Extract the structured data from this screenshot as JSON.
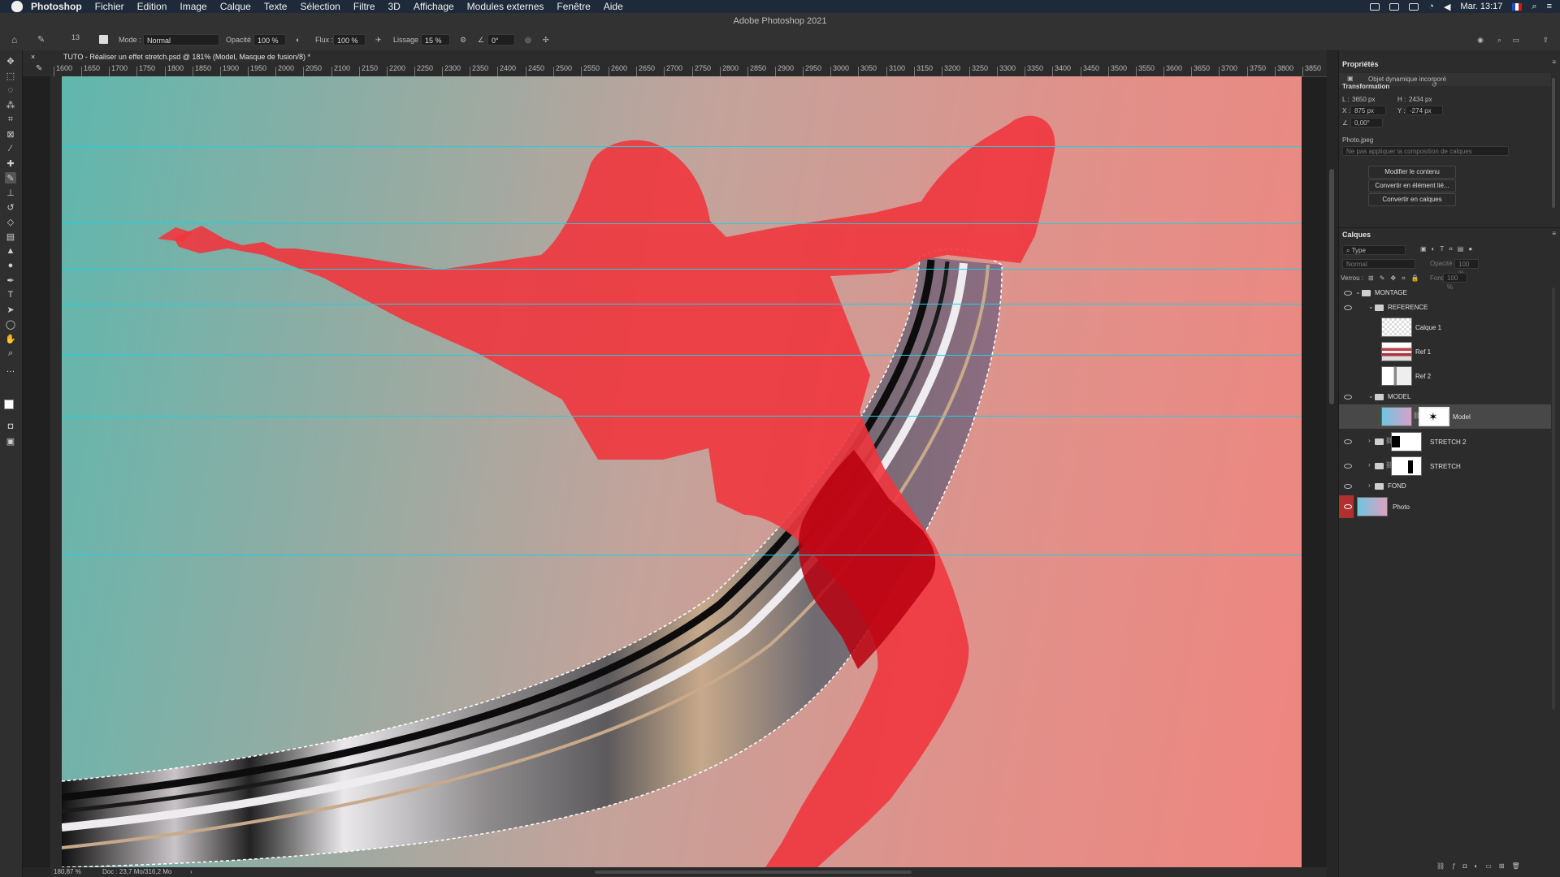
{
  "menubar": {
    "app": "Photoshop",
    "items": [
      "Fichier",
      "Edition",
      "Image",
      "Calque",
      "Texte",
      "Sélection",
      "Filtre",
      "3D",
      "Affichage",
      "Modules externes",
      "Fenêtre",
      "Aide"
    ],
    "clock": "Mar. 13:17"
  },
  "window": {
    "title": "Adobe Photoshop 2021"
  },
  "options": {
    "brush_size": "13",
    "mode_label": "Mode :",
    "mode_value": "Normal",
    "opacity_label": "Opacité :",
    "opacity_value": "100 %",
    "flow_label": "Flux :",
    "flow_value": "100 %",
    "smoothing_label": "Lissage :",
    "smoothing_value": "15 %",
    "angle_value": "0°"
  },
  "document": {
    "tab_title": "TUTO - Réaliser un effet stretch.psd @ 181% (Model, Masque de fusion/8) *",
    "ruler_ticks": [
      "1600",
      "1650",
      "1700",
      "1750",
      "1800",
      "1850",
      "1900",
      "1950",
      "2000",
      "2050",
      "2100",
      "2150",
      "2200",
      "2250",
      "2300",
      "2350",
      "2400",
      "2450",
      "2500",
      "2550",
      "2600",
      "2650",
      "2700",
      "2750",
      "2800",
      "2850",
      "2900",
      "2950",
      "3000",
      "3050",
      "3100",
      "3150",
      "3200",
      "3250",
      "3300",
      "3350",
      "3400",
      "3450",
      "3500",
      "3550",
      "3600",
      "3650",
      "3700",
      "3750",
      "3800",
      "3850"
    ],
    "zoom": "180,87 %",
    "doc_size": "Doc : 23,7 Mo/316,2 Mo"
  },
  "properties": {
    "title": "Propriétés",
    "object_type": "Objet dynamique incorporé",
    "transform_title": "Transformation",
    "w_label": "L :",
    "w_value": "3650 px",
    "h_label": "H :",
    "h_value": "2434 px",
    "x_label": "X :",
    "x_value": "875 px",
    "y_label": "Y :",
    "y_value": "-274 px",
    "angle_value": "0,00°",
    "source_file": "Photo.jpeg",
    "comp_placeholder": "Ne pas appliquer la composition de calques",
    "buttons": [
      "Modifier le contenu",
      "Convertir en élément lié...",
      "Convertir en calques"
    ]
  },
  "layers_panel": {
    "title": "Calques",
    "filter_value": "Type",
    "blend_value": "Normal",
    "opacity_label": "Opacité :",
    "opacity_value": "100 %",
    "lock_label": "Verrou :",
    "fill_label": "Fond :",
    "fill_value": "100 %",
    "layers": [
      {
        "name": "MONTAGE",
        "kind": "group"
      },
      {
        "name": "REFERENCE",
        "kind": "group"
      },
      {
        "name": "Calque 1",
        "kind": "layer"
      },
      {
        "name": "Ref 1",
        "kind": "layer"
      },
      {
        "name": "Ref 2",
        "kind": "layer"
      },
      {
        "name": "MODEL",
        "kind": "group"
      },
      {
        "name": "Model",
        "kind": "layer-mask"
      },
      {
        "name": "STRETCH 2",
        "kind": "group-mask"
      },
      {
        "name": "STRETCH",
        "kind": "group-mask"
      },
      {
        "name": "FOND",
        "kind": "group"
      },
      {
        "name": "Photo",
        "kind": "layer"
      }
    ]
  },
  "icons": {
    "tools": [
      "move-icon",
      "marquee-icon",
      "lasso-icon",
      "quick-select-icon",
      "crop-icon",
      "frame-icon",
      "eyedropper-icon",
      "healing-icon",
      "brush-icon",
      "stamp-icon",
      "history-brush-icon",
      "eraser-icon",
      "gradient-icon",
      "blur-icon",
      "dodge-icon",
      "pen-icon",
      "type-icon",
      "path-select-icon",
      "shape-icon",
      "hand-icon",
      "zoom-icon",
      "more-icon"
    ]
  },
  "colors": {
    "guide": "#19d2e6",
    "silhouette": "#f0363e",
    "selected_layer": "#484848",
    "photo_eye_bg": "#b03030"
  }
}
